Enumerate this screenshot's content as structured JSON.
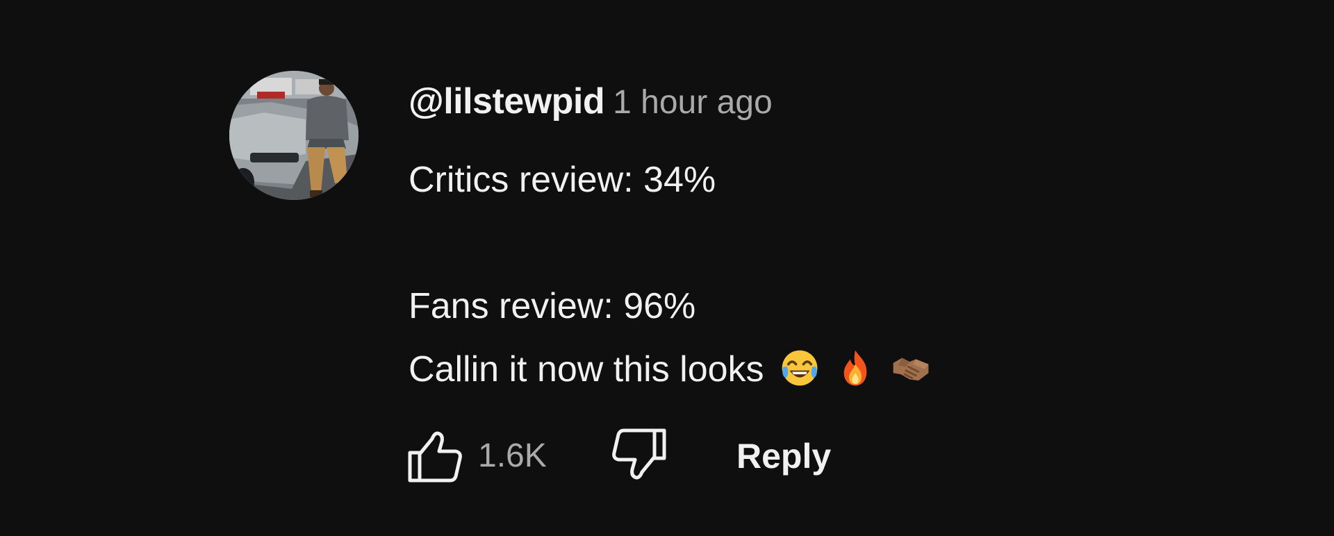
{
  "comment": {
    "author": "@lilstewpid",
    "timestamp": "1 hour ago",
    "lines": [
      "Critics review: 34%",
      "",
      "Fans review: 96%",
      "Callin it now this looks"
    ],
    "emojis": [
      "face-with-tears-of-joy",
      "fire",
      "handshake"
    ],
    "like_count": "1.6K",
    "reply_label": "Reply"
  },
  "colors": {
    "background": "#0f0f0f",
    "primary_text": "#f1f1f1",
    "secondary_text": "#aaaaaa"
  }
}
